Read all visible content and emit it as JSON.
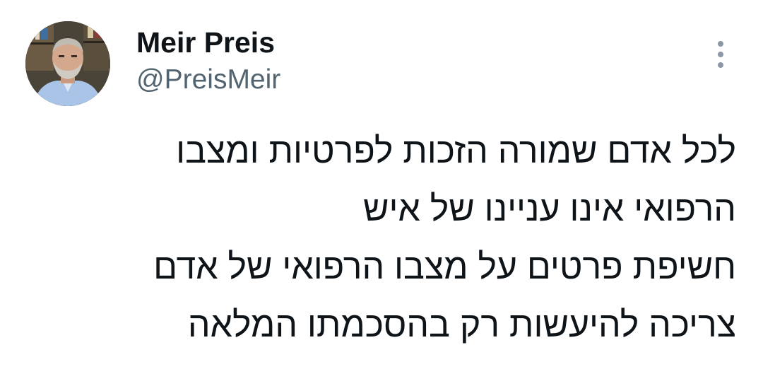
{
  "tweet": {
    "author": {
      "display_name": "Meir Preis",
      "handle": "@PreisMeir",
      "avatar_alt": "profile photo"
    },
    "more_icon": "more-vertical-icon",
    "text_lines": [
      "לכל אדם שמורה הזכות לפרטיות ומצבו",
      "הרפואי אינו עניינו של איש",
      "חשיפת פרטים על מצבו הרפואי של אדם",
      "צריכה להיעשות רק בהסכמתו המלאה"
    ]
  },
  "colors": {
    "text_primary": "#0f1419",
    "text_secondary": "#536471",
    "icon_gray": "#8b98a5",
    "background": "#ffffff"
  }
}
